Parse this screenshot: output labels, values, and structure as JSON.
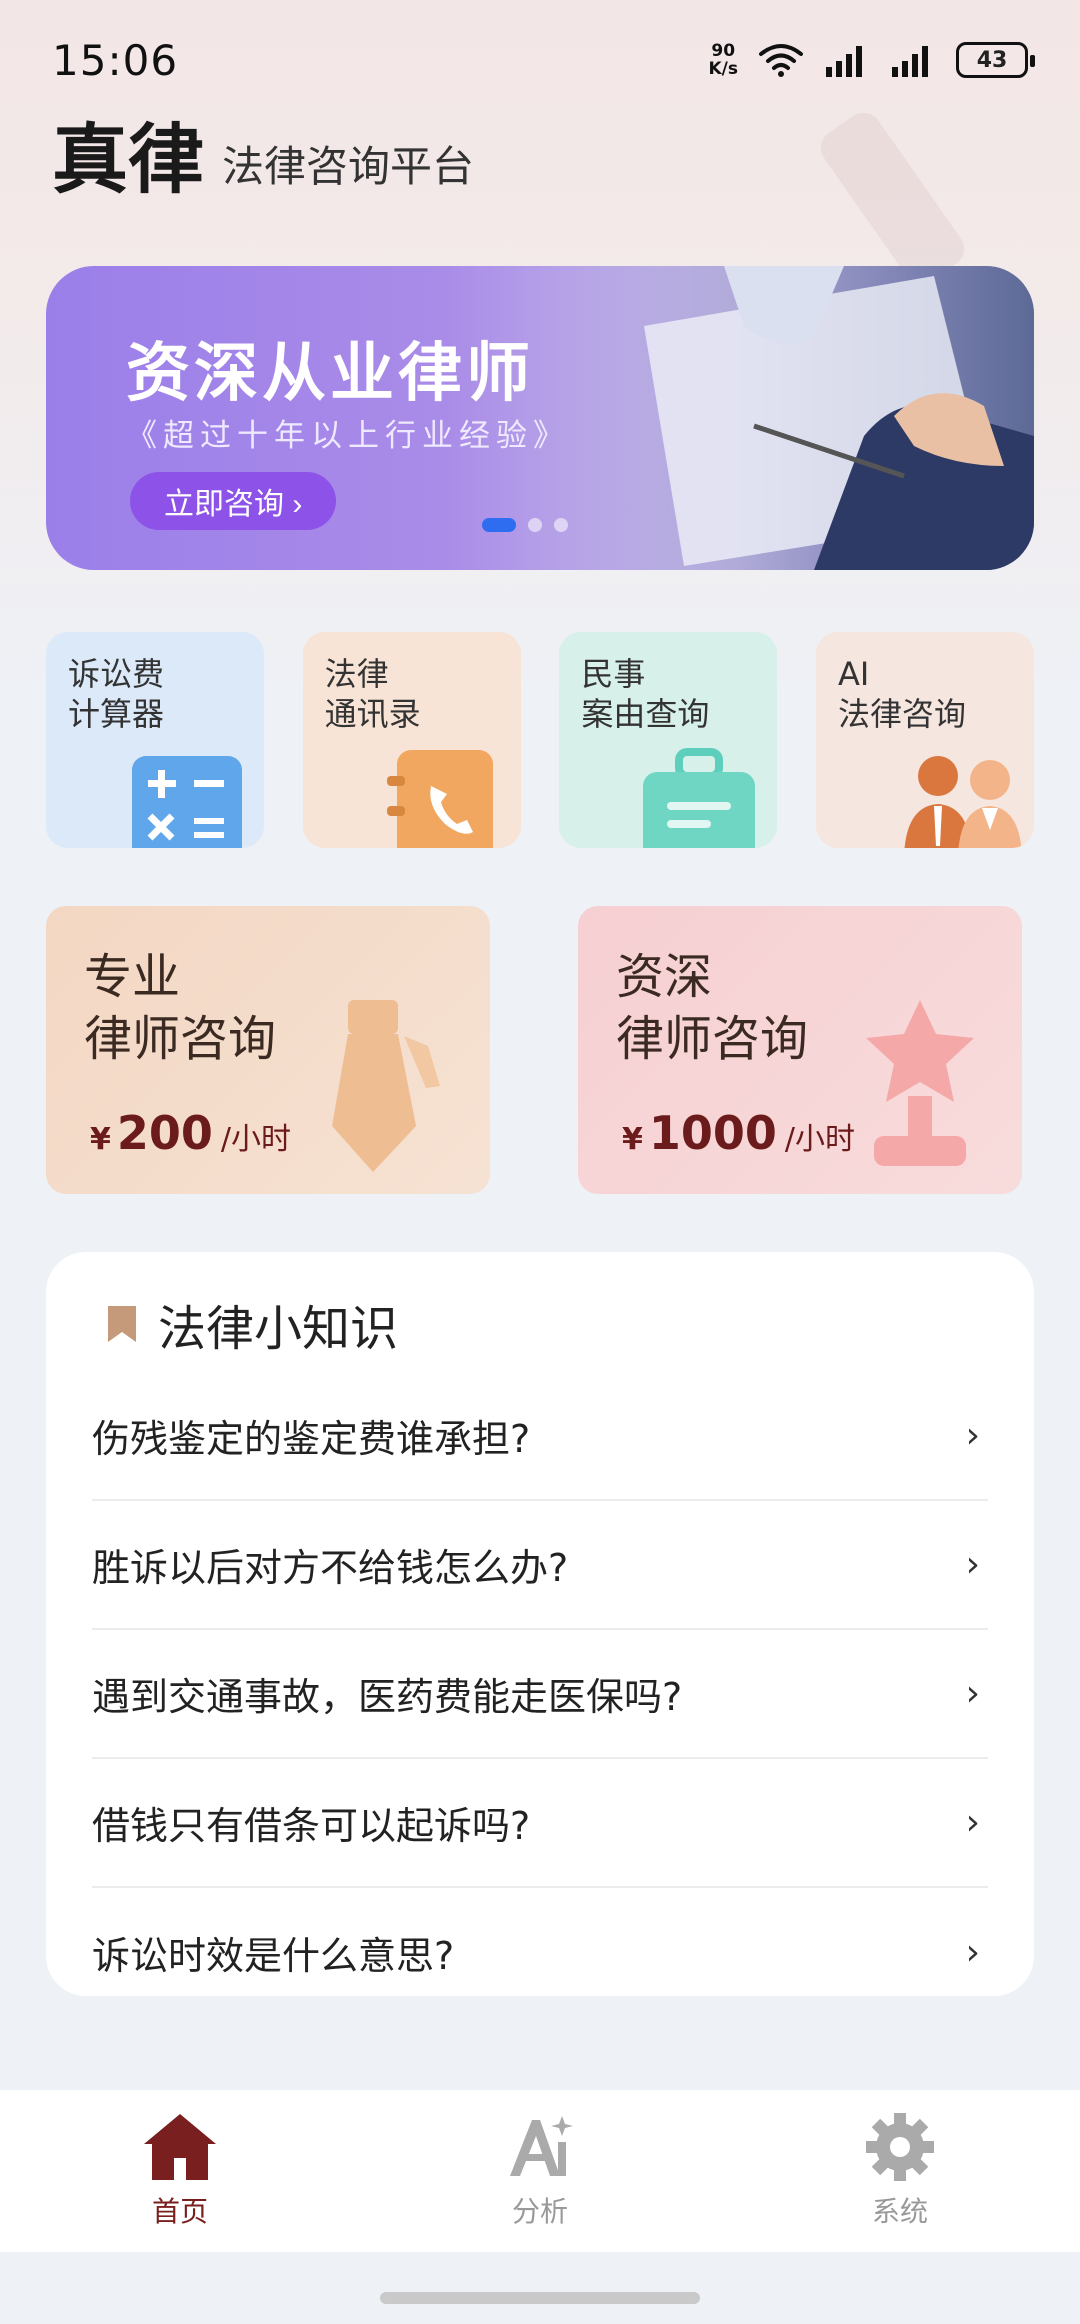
{
  "status": {
    "time": "15:06",
    "net_speed_value": "90",
    "net_speed_unit": "K/s",
    "battery": "43"
  },
  "header": {
    "title": "真律",
    "subtitle": "法律咨询平台"
  },
  "banner": {
    "title": "资深从业律师",
    "subtitle": "《超过十年以上行业经验》",
    "button_label": "立即咨询 ›",
    "pages": 3,
    "active_page": 1
  },
  "tiles": [
    {
      "label": "诉讼费\n计算器",
      "icon": "calculator-icon"
    },
    {
      "label": "法律\n通讯录",
      "icon": "phone-book-icon"
    },
    {
      "label": "民事\n案由查询",
      "icon": "briefcase-icon"
    },
    {
      "label": "AI\n法律咨询",
      "icon": "lawyers-icon"
    }
  ],
  "consult": [
    {
      "title": "专业\n律师咨询",
      "currency": "¥",
      "price": "200",
      "unit": "/小时",
      "icon": "tie-icon"
    },
    {
      "title": "资深\n律师咨询",
      "currency": "¥",
      "price": "1000",
      "unit": "/小时",
      "icon": "trophy-icon"
    }
  ],
  "knowledge": {
    "title": "法律小知识",
    "items": [
      "伤残鉴定的鉴定费谁承担?",
      "胜诉以后对方不给钱怎么办?",
      "遇到交通事故，医药费能走医保吗?",
      "借钱只有借条可以起诉吗?",
      "诉讼时效是什么意思?"
    ]
  },
  "nav": [
    {
      "label": "首页",
      "icon": "home-icon",
      "active": true
    },
    {
      "label": "分析",
      "icon": "ai-analysis-icon",
      "active": false
    },
    {
      "label": "系统",
      "icon": "gear-icon",
      "active": false
    }
  ],
  "colors": {
    "accent": "#7a1f1f",
    "banner_button": "#8d52e7",
    "dot_active": "#2f6df0"
  }
}
